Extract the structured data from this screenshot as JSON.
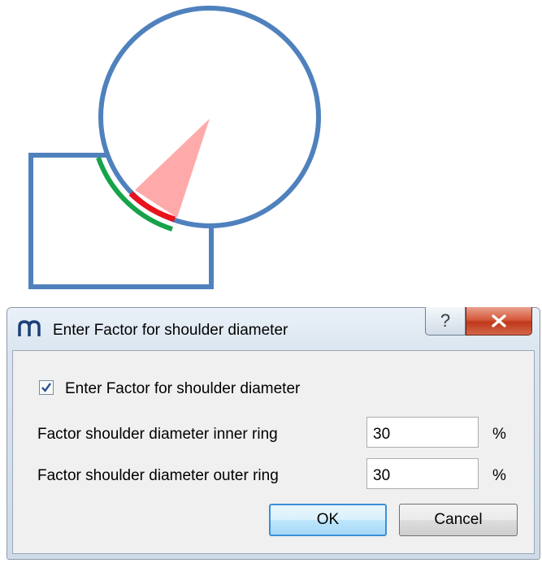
{
  "dialog": {
    "title": "Enter Factor for shoulder diameter",
    "help_label": "?",
    "checkbox": {
      "label": "Enter Factor for shoulder diameter",
      "checked": true
    },
    "fields": [
      {
        "label": "Factor shoulder diameter inner ring",
        "value": "30",
        "unit": "%"
      },
      {
        "label": "Factor shoulder diameter outer ring",
        "value": "30",
        "unit": "%"
      }
    ],
    "ok_label": "OK",
    "cancel_label": "Cancel"
  },
  "colors": {
    "shape_outline": "#4f81bd",
    "contact_arc_outer": "#16a34a",
    "contact_arc_inner": "#e8141c",
    "wedge_fill": "#ffaaaa",
    "close_button": "#c0391b",
    "ok_border": "#3c8fd8"
  }
}
